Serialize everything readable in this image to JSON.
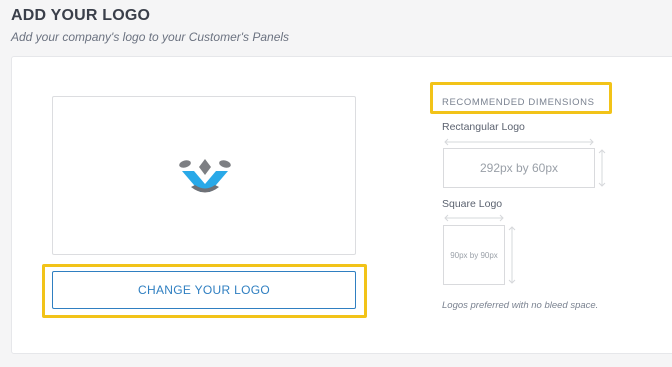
{
  "header": {
    "title": "ADD YOUR LOGO",
    "subtitle": "Add your company's logo to your Customer's Panels"
  },
  "logo_panel": {
    "logo_icon": "company-logo-icon",
    "change_button_label": "CHANGE YOUR LOGO"
  },
  "recommended": {
    "title": "RECOMMENDED DIMENSIONS",
    "rectangular_label": "Rectangular Logo",
    "rectangular_size": "292px by 60px",
    "square_label": "Square Logo",
    "square_size": "90px by 90px",
    "note": "Logos preferred with no bleed space."
  },
  "colors": {
    "accent": "#2f7fc1",
    "highlight": "#f2c318",
    "logo_blue": "#29a9e8",
    "logo_gray": "#7d7f83"
  }
}
